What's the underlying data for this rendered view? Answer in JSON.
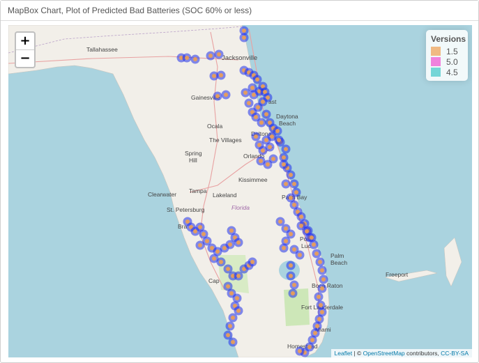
{
  "header": {
    "title": "MapBox Chart, Plot of Predicted Bad Batteries (SOC 60% or less)"
  },
  "zoom": {
    "in_label": "+",
    "out_label": "−"
  },
  "legend": {
    "title": "Versions",
    "items": [
      {
        "label": "1.5",
        "color": "#f0a050"
      },
      {
        "label": "5.0",
        "color": "#f050d0"
      },
      {
        "label": "4.5",
        "color": "#40c8c8"
      }
    ]
  },
  "colors": {
    "water": "#aad3df",
    "land": "#f2efe9",
    "marker_outer": "#2030e8",
    "marker_inner": "#f0a050"
  },
  "cities": [
    {
      "name": "Tallahassee"
    },
    {
      "name": "Jacksonville"
    },
    {
      "name": "Gainesville"
    },
    {
      "name": "Ocala"
    },
    {
      "name": "The Villages"
    },
    {
      "name": "Daytona"
    },
    {
      "name": "Beach"
    },
    {
      "name": "Deltona"
    },
    {
      "name": "Orlando"
    },
    {
      "name": "Spring"
    },
    {
      "name": "Hill"
    },
    {
      "name": "Kissimmee"
    },
    {
      "name": "Clearwater"
    },
    {
      "name": "Tampa"
    },
    {
      "name": "Lakeland"
    },
    {
      "name": "St. Petersburg"
    },
    {
      "name": "Bra"
    },
    {
      "name": "Palm Bay"
    },
    {
      "name": "Port"
    },
    {
      "name": "Luc"
    },
    {
      "name": "Palm"
    },
    {
      "name": "Beach"
    },
    {
      "name": "Boca Raton"
    },
    {
      "name": "Fort Lauderdale"
    },
    {
      "name": "Homestead"
    },
    {
      "name": "Miami"
    },
    {
      "name": "Cap"
    },
    {
      "name": "Freeport"
    },
    {
      "name": "ast"
    }
  ],
  "state_label": "Florida",
  "attribution": {
    "leaflet": "Leaflet",
    "sep": " | © ",
    "osm": "OpenStreetMap",
    "contrib": " contributors, ",
    "license": "CC-BY-SA"
  }
}
